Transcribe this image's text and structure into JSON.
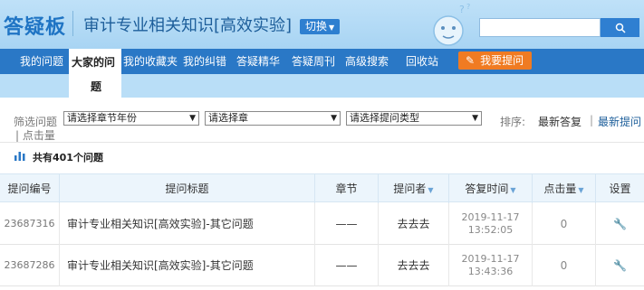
{
  "header": {
    "logo": "答疑板",
    "subject": "审计专业相关知识[高效实验]",
    "switch_label": "切换",
    "search_placeholder": ""
  },
  "nav": {
    "items": [
      "我的问题",
      "大家的问题",
      "我的收藏夹",
      "我的纠错",
      "答疑精华",
      "答疑周刊",
      "高级搜索",
      "回收站"
    ],
    "active_line1": "大家的问",
    "active_line2": "题",
    "ask_button": "我要提问"
  },
  "filter": {
    "label": "筛选问题",
    "select_year": "请选择章节年份",
    "select_chapter": "请选择章",
    "select_type": "请选择提问类型",
    "sort_label": "排序:",
    "sort_latest_answer": "最新答复",
    "sort_latest_question": "最新提问",
    "sort_clicks": "点击量"
  },
  "summary": {
    "total_text": "共有401个问题"
  },
  "table": {
    "headers": [
      "提问编号",
      "提问标题",
      "章节",
      "提问者",
      "答复时间",
      "点击量",
      "设置"
    ],
    "rows": [
      {
        "id": "23687316",
        "title": "审计专业相关知识[高效实验]-其它问题",
        "chapter": "——",
        "asker": "去去去",
        "date": "2019-11-17",
        "time": "13:52:05",
        "clicks": "0"
      },
      {
        "id": "23687286",
        "title": "审计专业相关知识[高效实验]-其它问题",
        "chapter": "——",
        "asker": "去去去",
        "date": "2019-11-17",
        "time": "13:43:36",
        "clicks": "0"
      }
    ]
  },
  "colors": {
    "nav_bg": "#2a78c6",
    "header_bg": "#bfe1f8",
    "accent_orange": "#f07b22",
    "link_blue": "#1d5e9a"
  }
}
